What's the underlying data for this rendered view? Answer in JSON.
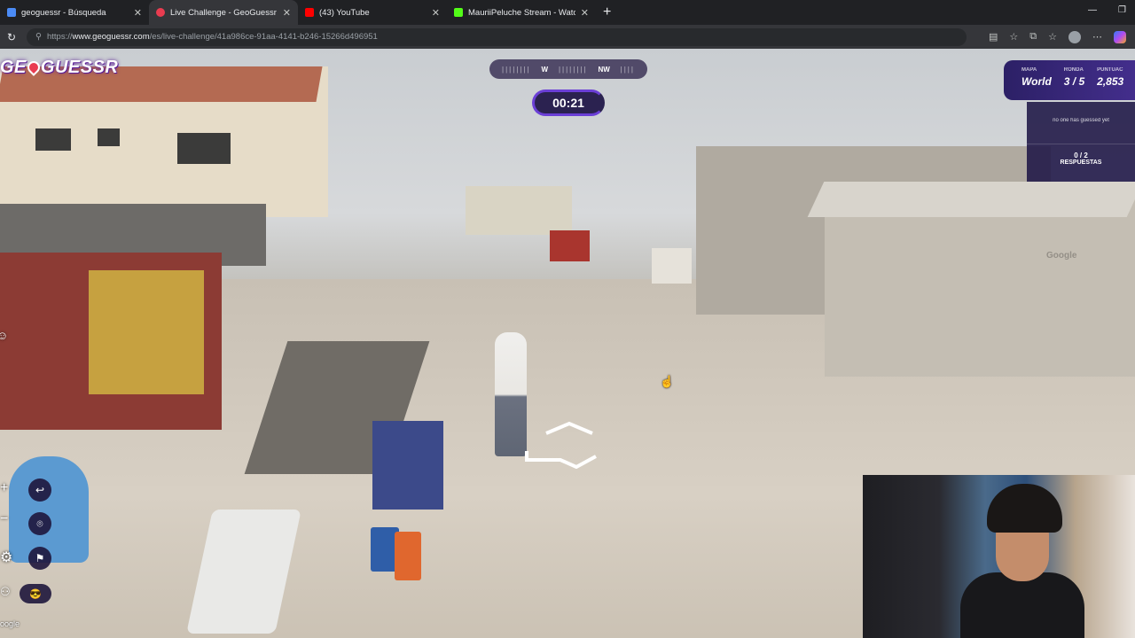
{
  "browser": {
    "tabs": [
      {
        "title": "geoguessr - Búsqueda",
        "favicon_color": "#4b8bf5",
        "active": false
      },
      {
        "title": "Live Challenge - GeoGuessr",
        "favicon_color": "#e93c50",
        "active": true
      },
      {
        "title": "(43) YouTube",
        "favicon_color": "#ff0000",
        "active": false
      },
      {
        "title": "MauriiPeluche Stream - Watch Liv…",
        "favicon_color": "#53fc18",
        "active": false
      }
    ],
    "new_tab": "+",
    "url_prefix": "https://",
    "url_host": "www.geoguessr.com",
    "url_path": "/es/live-challenge/41a986ce-91aa-4141-b246-15266d496951"
  },
  "game": {
    "logo": "GEOGUESSR",
    "compass": {
      "left": "W",
      "right": "NW"
    },
    "timer": "00:21",
    "status": {
      "map_label": "MAPA",
      "map_value": "World",
      "round_label": "RONDA",
      "round_value": "3 / 5",
      "score_label": "PUNTUAC",
      "score_value": "2,853"
    },
    "guesses": {
      "none_text": "no one has guessed yet",
      "count": "0 / 2",
      "label": "RESPUESTAS"
    },
    "watermark": "Google",
    "google_attribution": "oogle"
  },
  "colors": {
    "accent": "#6b3fd6",
    "panel": "#2c2066"
  }
}
